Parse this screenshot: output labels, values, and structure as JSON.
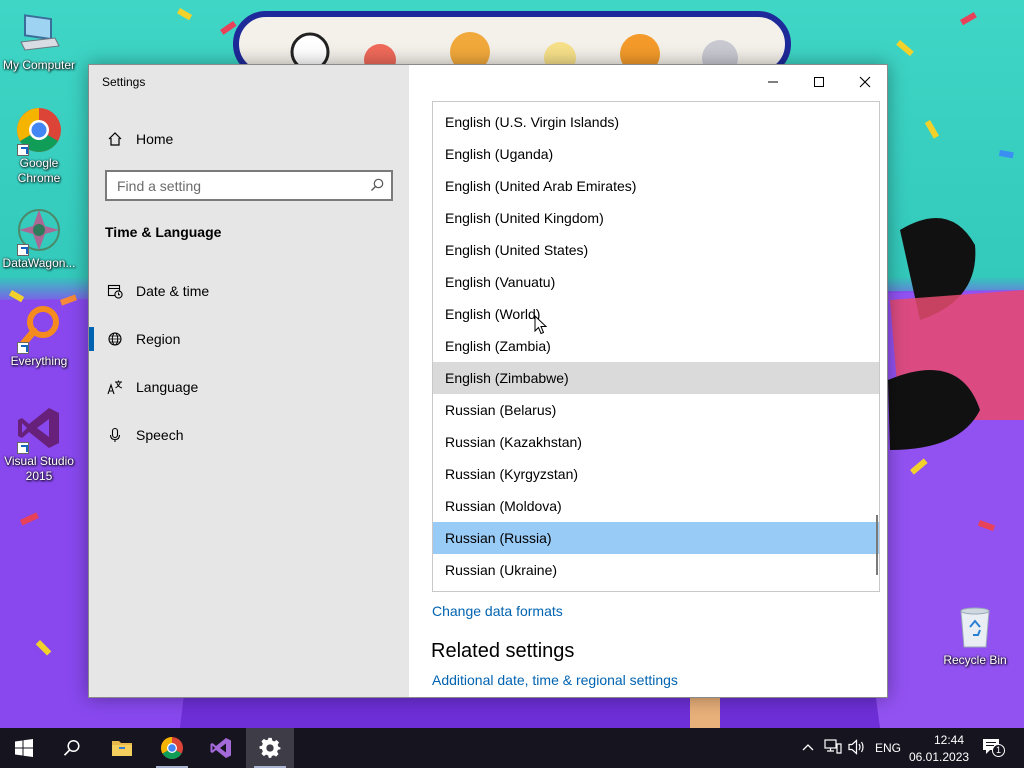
{
  "desktop": {
    "icons": [
      {
        "label": "My Computer",
        "icon": "computer-icon"
      },
      {
        "label": "Google Chrome",
        "icon": "chrome-icon"
      },
      {
        "label": "DataWagon...",
        "icon": "datawagon-icon"
      },
      {
        "label": "Everything",
        "icon": "everything-search-icon"
      },
      {
        "label": "Visual Studio 2015",
        "icon": "visual-studio-icon"
      },
      {
        "label": "Recycle Bin",
        "icon": "recycle-bin-icon"
      }
    ]
  },
  "window": {
    "title": "Settings",
    "controls": {
      "minimize": "minimize-icon",
      "maximize": "maximize-icon",
      "close": "close-icon"
    }
  },
  "nav": {
    "home": "Home",
    "search_placeholder": "Find a setting",
    "section_title": "Time & Language",
    "items": [
      {
        "label": "Date & time",
        "icon": "calendar-clock-icon"
      },
      {
        "label": "Region",
        "icon": "globe-icon",
        "selected": true
      },
      {
        "label": "Language",
        "icon": "language-icon"
      },
      {
        "label": "Speech",
        "icon": "microphone-icon"
      }
    ],
    "accent_color": "#0063b1"
  },
  "content": {
    "locales": [
      "English (U.S. Virgin Islands)",
      "English (Uganda)",
      "English (United Arab Emirates)",
      "English (United Kingdom)",
      "English (United States)",
      "English (Vanuatu)",
      "English (World)",
      "English (Zambia)",
      "English (Zimbabwe)",
      "Russian (Belarus)",
      "Russian (Kazakhstan)",
      "Russian (Kyrgyzstan)",
      "Russian (Moldova)",
      "Russian (Russia)",
      "Russian (Ukraine)"
    ],
    "hovered_locale": "English (Zimbabwe)",
    "selected_locale": "Russian (Russia)",
    "change_formats_link": "Change data formats",
    "related_heading": "Related settings",
    "additional_link": "Additional date, time & regional settings",
    "link_color": "#0063b1",
    "selected_color": "#99cbf7"
  },
  "taskbar": {
    "apps": [
      "start-icon",
      "search-icon",
      "file-explorer-icon",
      "chrome-icon",
      "visual-studio-icon",
      "settings-gear-icon"
    ],
    "active_app": "settings-gear-icon",
    "tray": {
      "language": "ENG",
      "time": "12:44",
      "date": "06.01.2023",
      "notification_count": "1"
    }
  }
}
